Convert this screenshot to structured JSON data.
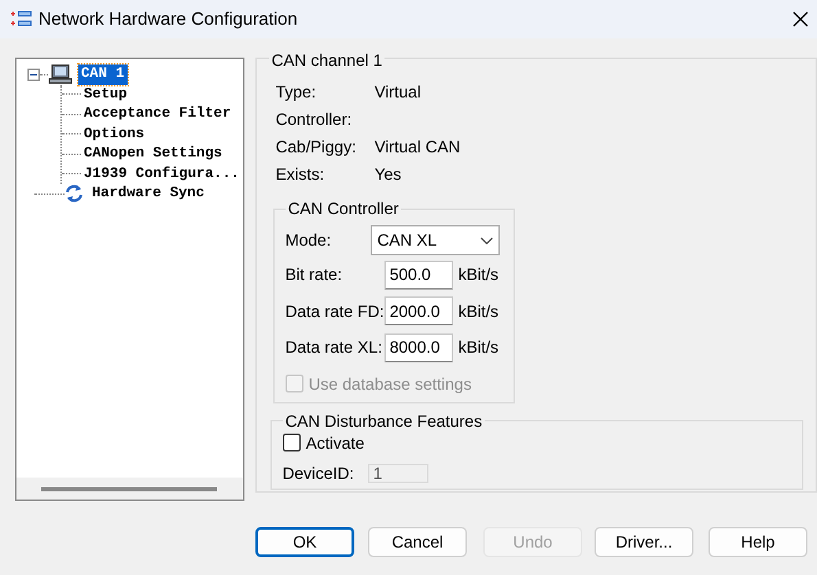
{
  "window": {
    "title": "Network Hardware Configuration"
  },
  "tree": [
    {
      "label": "CAN 1",
      "kind": "device",
      "selected": true,
      "expanded": true,
      "children": [
        {
          "label": "Setup",
          "selected": false
        },
        {
          "label": "Acceptance Filter",
          "selected": false
        },
        {
          "label": "Options",
          "selected": false
        },
        {
          "label": "CANopen Settings",
          "selected": false
        },
        {
          "label": "J1939 Configura...",
          "selected": false
        }
      ]
    },
    {
      "label": "Hardware Sync",
      "kind": "sync",
      "selected": false
    }
  ],
  "channel": {
    "title": "CAN channel 1",
    "fields": [
      {
        "label": "Type:",
        "value": "Virtual"
      },
      {
        "label": "Controller:"
      },
      {
        "label": "Cab/Piggy:",
        "value": "Virtual CAN"
      },
      {
        "label": "Exists:",
        "value": "Yes"
      }
    ]
  },
  "controller": {
    "title": "CAN Controller",
    "mode": {
      "label": "Mode:",
      "value": "CAN XL"
    },
    "rates": [
      {
        "label": "Bit rate:",
        "value": "500.0",
        "unit": "kBit/s"
      },
      {
        "label": "Data rate FD:",
        "value": "2000.0",
        "unit": "kBit/s"
      },
      {
        "label": "Data rate XL:",
        "value": "8000.0",
        "unit": "kBit/s"
      }
    ],
    "use_database": {
      "label": "Use database settings",
      "checked": false,
      "disabled": true
    }
  },
  "disturbance": {
    "title": "CAN Disturbance Features",
    "activate": {
      "label": "Activate",
      "checked": false,
      "disabled": false
    },
    "device_id": {
      "label": "DeviceID:",
      "value": "1",
      "disabled": true
    }
  },
  "buttons": [
    {
      "label": "OK",
      "default": true,
      "disabled": false
    },
    {
      "label": "Cancel",
      "default": false,
      "disabled": false
    },
    {
      "label": "Undo",
      "default": false,
      "disabled": true
    },
    {
      "label": "Driver...",
      "default": false,
      "disabled": false
    },
    {
      "label": "Help",
      "default": false,
      "disabled": false
    }
  ]
}
